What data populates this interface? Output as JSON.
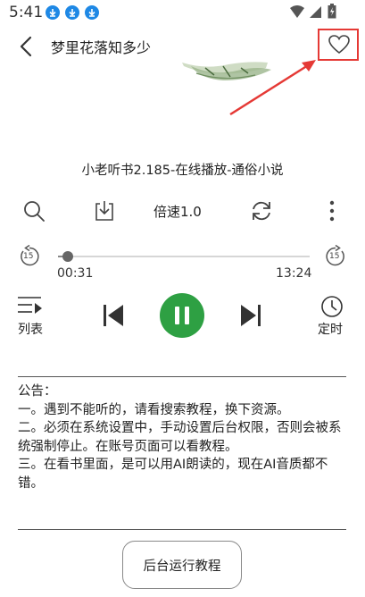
{
  "status_bar": {
    "time": "5:41",
    "icons": [
      "download-icon",
      "download-icon",
      "download-icon",
      "wifi-icon",
      "signal-icon",
      "battery-icon"
    ]
  },
  "header": {
    "title": "梦里花落知多少",
    "back_icon": "chevron-left-icon",
    "favorite_icon": "heart-icon"
  },
  "player": {
    "book_title": "小老听书2.185-在线播放-通俗小说",
    "toolbar": {
      "search_icon": "search-icon",
      "download_icon": "download-icon",
      "speed_label": "倍速1.0",
      "refresh_icon": "refresh-icon",
      "more_icon": "more-vertical-icon"
    },
    "progress": {
      "current": "00:31",
      "total": "13:24",
      "fraction": 0.04,
      "skip_back_label": "15",
      "skip_forward_label": "15"
    },
    "controls": {
      "list_label": "列表",
      "timer_label": "定时",
      "state": "playing"
    }
  },
  "notice": {
    "heading": "公告：",
    "items": [
      "一。遇到不能听的，请看搜索教程，换下资源。",
      "二。必须在系统设置中，手动设置后台权限，否则会被系统强制停止。在账号页面可以看教程。",
      "三。在看书里面，是可以用AI朗读的，现在AI音质都不错。"
    ]
  },
  "background_run_button": "后台运行教程",
  "colors": {
    "accent_green": "#2ea043",
    "annotation_red": "#e53935",
    "download_blue": "#1e88e5"
  }
}
